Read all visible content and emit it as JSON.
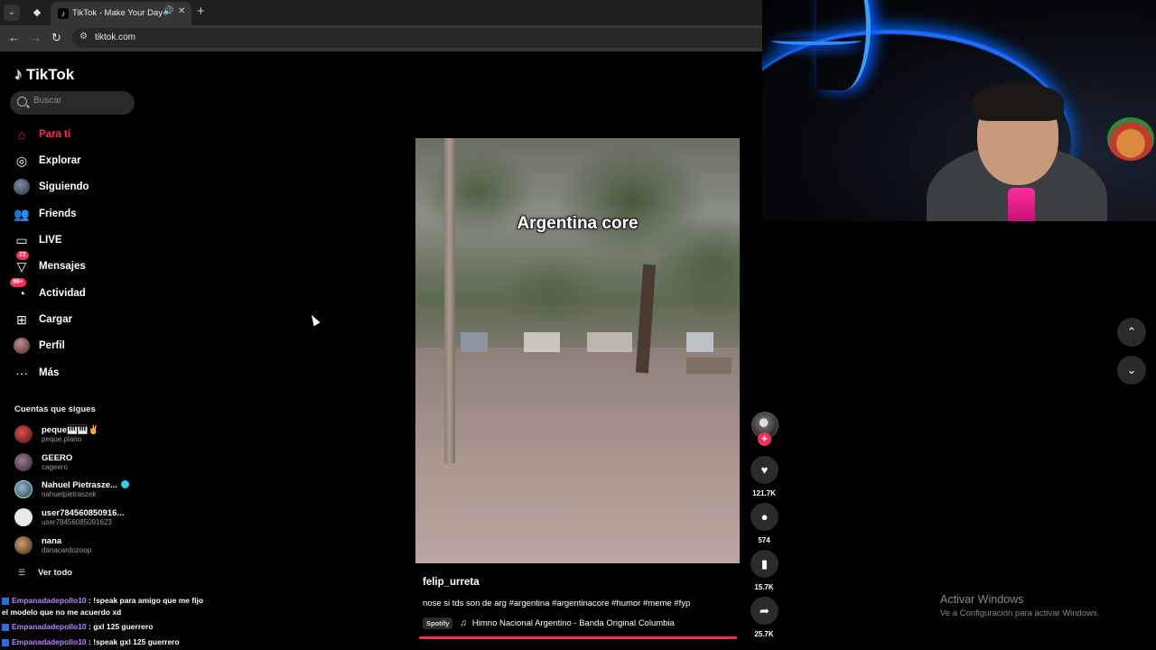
{
  "browser": {
    "tab_title": "TikTok - Make Your Day",
    "url": "tiktok.com",
    "tab_menu_icon": "chevron-down-icon",
    "new_tab": "+",
    "close": "✕"
  },
  "sidebar": {
    "logo": "TikTok",
    "search_placeholder": "Buscar",
    "nav": [
      {
        "label": "Para ti",
        "icon": "home-icon",
        "active": true
      },
      {
        "label": "Explorar",
        "icon": "compass-icon"
      },
      {
        "label": "Siguiendo",
        "icon": "following-avatar-icon"
      },
      {
        "label": "Friends",
        "icon": "friends-icon"
      },
      {
        "label": "LIVE",
        "icon": "live-icon"
      },
      {
        "label": "Mensajes",
        "icon": "inbox-icon",
        "badge": "22"
      },
      {
        "label": "Actividad",
        "icon": "activity-icon",
        "badge": "99+"
      },
      {
        "label": "Cargar",
        "icon": "upload-icon"
      },
      {
        "label": "Perfil",
        "icon": "profile-avatar-icon"
      },
      {
        "label": "Más",
        "icon": "more-icon"
      }
    ],
    "following_header": "Cuentas que sigues",
    "accounts": [
      {
        "name": "peque🎹🎹✌",
        "username": "peque.plano",
        "color": "#b0282a"
      },
      {
        "name": "GEERO",
        "username": "cageero",
        "color": "#6a4f66"
      },
      {
        "name": "Nahuel Pietrasze...",
        "username": "nahuelpietraszek",
        "verified": true,
        "color": "#4d6a8a"
      },
      {
        "name": "user7845608509​16...",
        "username": "user78456085091623",
        "color": "#e8e8e8"
      },
      {
        "name": "nana",
        "username": "danacardozoop",
        "color": "#a07a56"
      }
    ],
    "see_all": "Ver todo"
  },
  "chat": [
    {
      "user": "Empanadadepollo10",
      "message": ": !speak para amigo que me fijo el modelo que no me acuerdo xd"
    },
    {
      "user": "Empanadadepollo10",
      "message": ": gxl 125 guerrero"
    },
    {
      "user": "Empanadadepollo10",
      "message": ": !speak gxl 125 guerrero"
    }
  ],
  "video": {
    "overlay_text": "Argentina core",
    "author": "felip_urreta",
    "description": "nose si tds son de arg #argentina #argentinacore #humor #meme #fyp",
    "spotify_tag": "Spotify",
    "music": "Himno Nacional Argentino - Banda Original Columbia",
    "progress": 1.0
  },
  "actions": {
    "likes": "121.7K",
    "comments": "574",
    "saves": "15.7K",
    "shares": "25.7K"
  },
  "windows_activation": {
    "title": "Activar Windows",
    "subtitle": "Ve a Configuración para activar Windows."
  }
}
